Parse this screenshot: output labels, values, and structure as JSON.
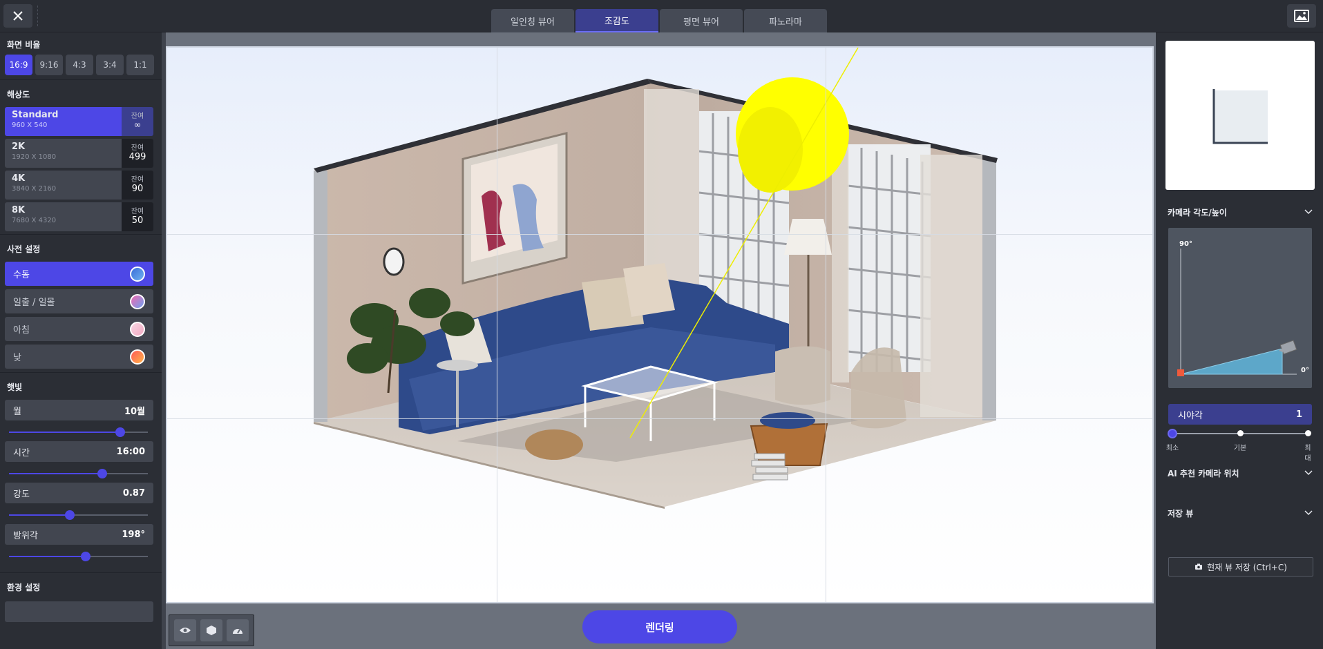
{
  "tabs": [
    {
      "label": "일인칭 뷰어"
    },
    {
      "label": "조감도"
    },
    {
      "label": "평면 뷰어"
    },
    {
      "label": "파노라마"
    }
  ],
  "left": {
    "ratio_title": "화면 비율",
    "ratios": [
      "16:9",
      "9:16",
      "4:3",
      "3:4",
      "1:1"
    ],
    "resolution_title": "해상도",
    "remaining_label": "잔여",
    "resolutions": [
      {
        "name": "Standard",
        "size": "960 X 540",
        "remaining": "∞"
      },
      {
        "name": "2K",
        "size": "1920 X 1080",
        "remaining": "499"
      },
      {
        "name": "4K",
        "size": "3840 X 2160",
        "remaining": "90"
      },
      {
        "name": "8K",
        "size": "7680 X 4320",
        "remaining": "50"
      }
    ],
    "preset_title": "사전 설정",
    "presets": [
      {
        "label": "수동"
      },
      {
        "label": "일출 / 일몰"
      },
      {
        "label": "아침"
      },
      {
        "label": "낮"
      }
    ],
    "sunlight_title": "햇빛",
    "controls": [
      {
        "label": "월",
        "value": "10월",
        "position": 0.8
      },
      {
        "label": "시간",
        "value": "16:00",
        "position": 0.67
      },
      {
        "label": "강도",
        "value": "0.87",
        "position": 0.44
      },
      {
        "label": "방위각",
        "value": "198°",
        "position": 0.55
      }
    ],
    "env_title": "환경 설정"
  },
  "right": {
    "camera_title": "카메라 각도/높이",
    "angle_top": "90°",
    "angle_right": "0°",
    "fov_label": "시야각",
    "fov_value": "1",
    "fov_stops": [
      "최소",
      "기본",
      "최대"
    ],
    "ai_title": "AI 추천 카메라 위치",
    "saved_title": "저장 뷰",
    "save_button": "현재 뷰 저장 (Ctrl+C)"
  },
  "render_button": "렌더링",
  "colors": {
    "accent": "#4d47e6",
    "sun": "#ffff00",
    "sofa": "#2e4a8a"
  }
}
